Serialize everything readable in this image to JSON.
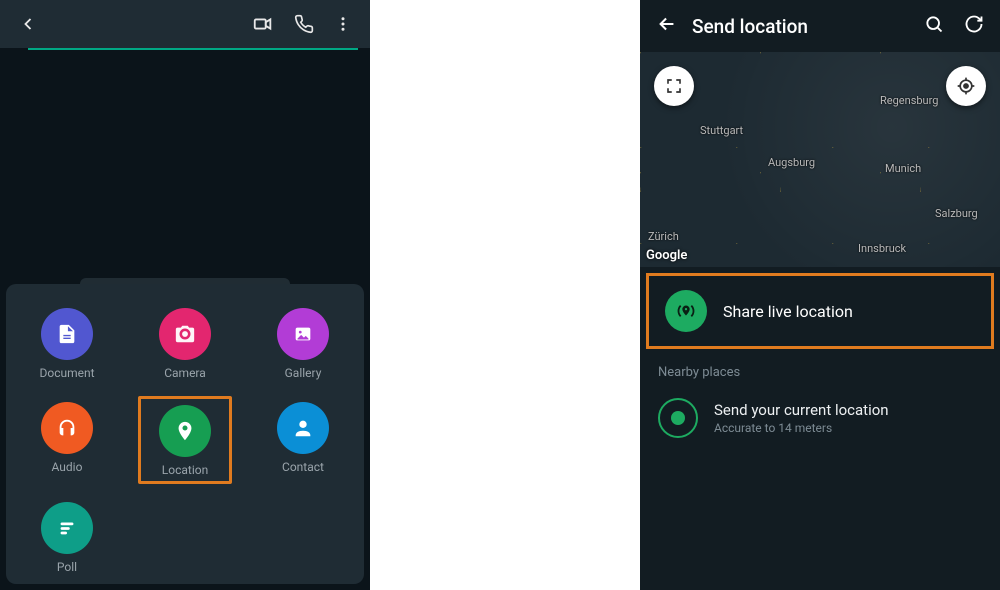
{
  "left": {
    "attachments": {
      "document": "Document",
      "camera": "Camera",
      "gallery": "Gallery",
      "audio": "Audio",
      "location": "Location",
      "contact": "Contact",
      "poll": "Poll"
    }
  },
  "right": {
    "title": "Send location",
    "map": {
      "attribution": "Google",
      "cities": {
        "stuttgart": "Stuttgart",
        "regensburg": "Regensburg",
        "augsburg": "Augsburg",
        "munich": "Munich",
        "salzburg": "Salzburg",
        "zurich": "Zürich",
        "innsbruck": "Innsbruck"
      }
    },
    "share_live_label": "Share live location",
    "nearby_label": "Nearby places",
    "current": {
      "title": "Send your current location",
      "subtitle": "Accurate to 14 meters"
    }
  },
  "colors": {
    "highlight": "#e07b1f",
    "accent_green": "#1DAB61",
    "bg_dark": "#121C22"
  }
}
